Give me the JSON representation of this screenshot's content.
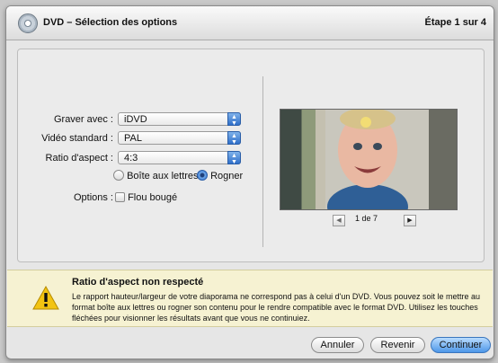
{
  "window": {
    "title": "DVD – Sélection des options",
    "step": "Étape 1 sur 4"
  },
  "form": {
    "burn_label": "Graver avec :",
    "burn_value": "iDVD",
    "video_label": "Vidéo standard :",
    "video_value": "PAL",
    "ratio_label": "Ratio d'aspect :",
    "ratio_value": "4:3",
    "radio_letterbox": "Boîte aux lettres",
    "radio_crop": "Rogner",
    "selected_radio": "Rogner",
    "options_label": "Options :",
    "blur_label": "Flou bougé",
    "blur_checked": false
  },
  "preview": {
    "counter": "1 de 7"
  },
  "warning": {
    "title": "Ratio d'aspect non respecté",
    "text": "Le rapport hauteur/largeur de votre diaporama ne correspond pas à celui d'un DVD. Vous pouvez soit le mettre au format boîte aux lettres ou rogner son contenu pour le rendre compatible avec le format DVD. Utilisez les touches fléchées pour visionner les résultats avant que vous ne continuiez."
  },
  "buttons": {
    "cancel": "Annuler",
    "back": "Revenir",
    "continue": "Continuer"
  },
  "colors": {
    "accent": "#3a78d0",
    "warning_bg": "#f6f2d2"
  },
  "icons": {
    "title": "dvd-icon",
    "warning": "warning-icon",
    "prev": "left-arrow-icon",
    "next": "right-arrow-icon"
  }
}
